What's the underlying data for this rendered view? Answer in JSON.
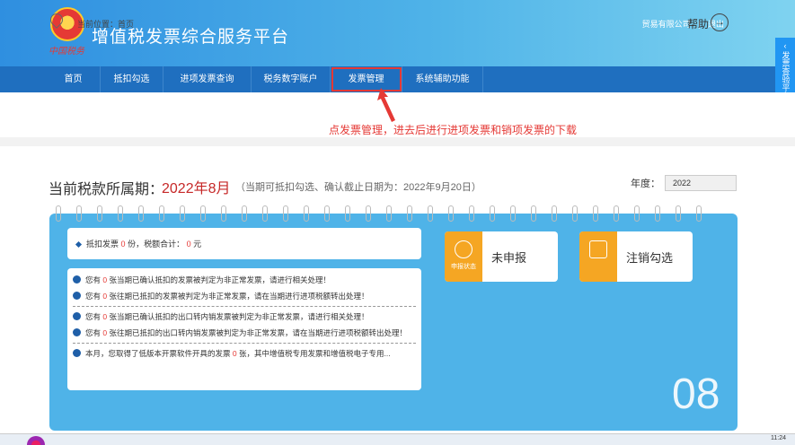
{
  "header": {
    "emblem_text": "中国税务",
    "title": "增值税发票综合服务平台",
    "company": "贸易有限公司",
    "separator": "|",
    "logout": "退出"
  },
  "nav": [
    {
      "label": "首页"
    },
    {
      "label": "抵扣勾选"
    },
    {
      "label": "进项发票查询"
    },
    {
      "label": "税务数字账户"
    },
    {
      "label": "发票管理"
    },
    {
      "label": "系统辅助功能"
    }
  ],
  "side_tab": {
    "label": "发票查验平台"
  },
  "breadcrumb": {
    "text": "当前位置：首页"
  },
  "help": {
    "label": "帮助",
    "icon_glyph": "→"
  },
  "annotation": {
    "text": "点发票管理，进去后进行进项发票和销项发票的下载"
  },
  "period": {
    "label": "当前税款所属期：",
    "value": "2022年8月",
    "note": "（当期可抵扣勾选、确认截止日期为：2022年9月20日）"
  },
  "year": {
    "label": "年度：",
    "value": "2022"
  },
  "summary": {
    "prefix": "抵扣发票",
    "count": "0",
    "count_unit": "份，税额合计：",
    "amount": "0",
    "amount_unit": "元"
  },
  "messages": [
    {
      "pre": "您有",
      "num": "0",
      "post": "张当期已确认抵扣的发票被判定为非正常发票，请进行相关处理！"
    },
    {
      "pre": "您有",
      "num": "0",
      "post": "张往期已抵扣的发票被判定为非正常发票，请在当期进行进项税额转出处理！"
    },
    {
      "pre": "您有",
      "num": "0",
      "post": "张当期已确认抵扣的出口转内销发票被判定为非正常发票，请进行相关处理！"
    },
    {
      "pre": "您有",
      "num": "0",
      "post": "张往期已抵扣的出口转内销发票被判定为非正常发票，请在当期进行进项税额转出处理！"
    },
    {
      "pre": "本月，您取得了低版本开票软件开具的发票",
      "num": "0",
      "post": "张，其中增值税专用发票和增值税电子专用..."
    }
  ],
  "tiles": {
    "status": {
      "icon_caption": "申报状态",
      "label": "未申报"
    },
    "cancel": {
      "label": "注销勾选"
    }
  },
  "calendar": {
    "month": "08"
  },
  "taskbar": {
    "clock": "11:24"
  }
}
